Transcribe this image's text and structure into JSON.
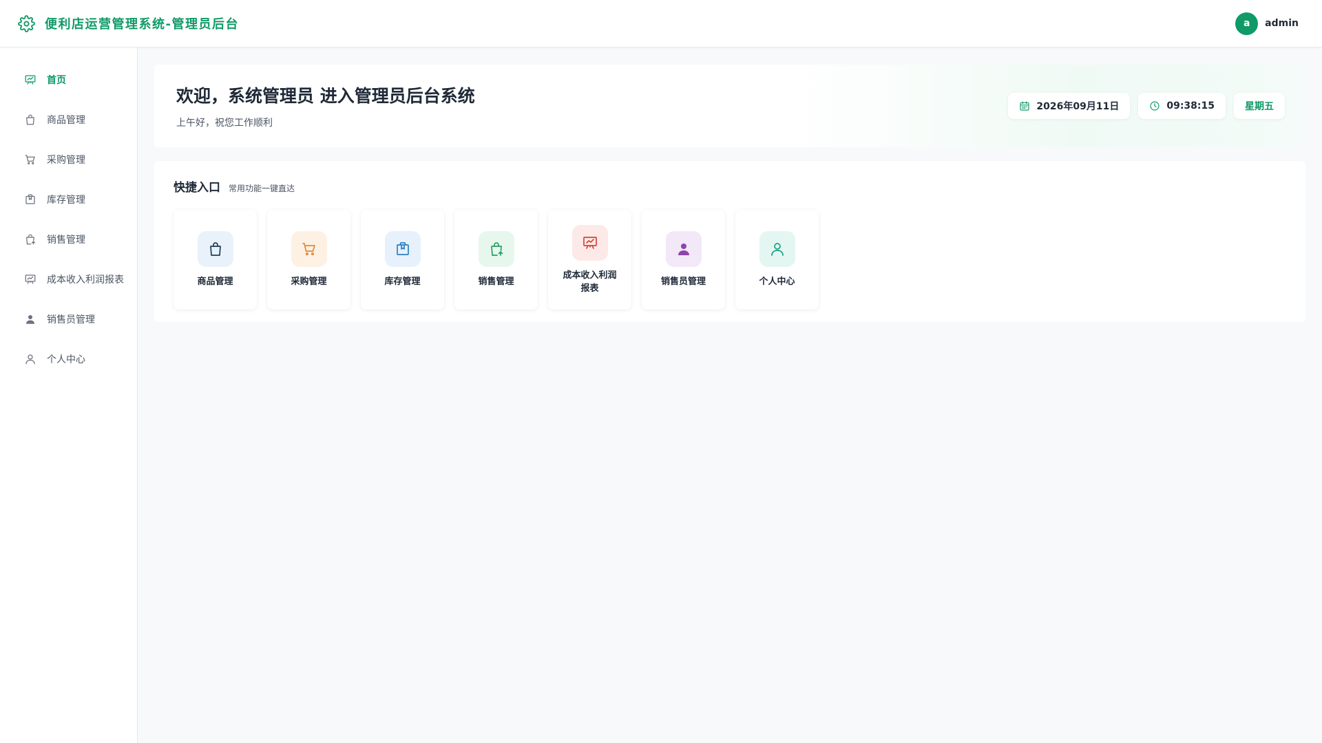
{
  "header": {
    "brand_title": "便利店运营管理系统-管理员后台",
    "brand_icon": "gear-icon",
    "user": {
      "avatar_letter": "a",
      "name": "admin"
    }
  },
  "colors": {
    "accent": "#0f9a68",
    "background": "#f8f9fb"
  },
  "sidebar": {
    "items": [
      {
        "label": "首页",
        "icon": "presentation-board-icon",
        "active": true
      },
      {
        "label": "商品管理",
        "icon": "shopping-bag-icon",
        "active": false
      },
      {
        "label": "采购管理",
        "icon": "cart-icon",
        "active": false
      },
      {
        "label": "库存管理",
        "icon": "box-icon",
        "active": false
      },
      {
        "label": "销售管理",
        "icon": "bag-upload-icon",
        "active": false
      },
      {
        "label": "成本收入利润报表",
        "icon": "presentation-board-icon",
        "active": false
      },
      {
        "label": "销售员管理",
        "icon": "person-filled-icon",
        "active": false
      },
      {
        "label": "个人中心",
        "icon": "person-outline-icon",
        "active": false
      }
    ]
  },
  "welcome": {
    "title": "欢迎，系统管理员 进入管理员后台系统",
    "subtitle": "上午好，祝您工作顺利",
    "date": "2026年09月11日",
    "time": "09:38:15",
    "weekday": "星期五"
  },
  "quick": {
    "title": "快捷入口",
    "subtitle": "常用功能一键直达",
    "cards": [
      {
        "label": "商品管理",
        "icon": "shopping-bag-icon",
        "color": "#1f3b57",
        "bg": "#e9f2fb"
      },
      {
        "label": "采购管理",
        "icon": "cart-icon",
        "color": "#e0893a",
        "bg": "#fdf1e4"
      },
      {
        "label": "库存管理",
        "icon": "box-icon",
        "color": "#2b7fc4",
        "bg": "#e6f1fb"
      },
      {
        "label": "销售管理",
        "icon": "bag-upload-icon",
        "color": "#27a05f",
        "bg": "#e7f7ee"
      },
      {
        "label": "成本收入利润报表",
        "icon": "presentation-board-icon",
        "color": "#d1453b",
        "bg": "#fde9e7"
      },
      {
        "label": "销售员管理",
        "icon": "person-filled-icon",
        "color": "#8e44ad",
        "bg": "#f2e8f8"
      },
      {
        "label": "个人中心",
        "icon": "person-outline-icon",
        "color": "#16a085",
        "bg": "#e4f6f2"
      }
    ]
  }
}
